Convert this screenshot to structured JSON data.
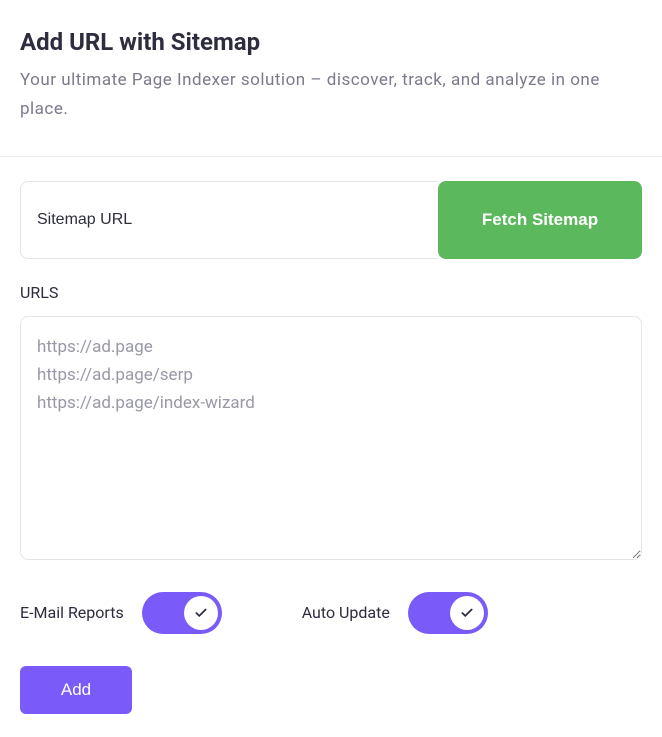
{
  "header": {
    "title": "Add URL with Sitemap",
    "subtitle": "Your ultimate Page Indexer solution – discover, track, and analyze in one place."
  },
  "form": {
    "sitemap_placeholder": "Sitemap URL",
    "sitemap_value": "",
    "fetch_button_label": "Fetch Sitemap",
    "urls_label": "URLS",
    "urls_value": "https://ad.page\nhttps://ad.page/serp\nhttps://ad.page/index-wizard"
  },
  "toggles": {
    "email_reports": {
      "label": "E-Mail Reports",
      "on": true
    },
    "auto_update": {
      "label": "Auto Update",
      "on": true
    }
  },
  "actions": {
    "add_label": "Add"
  },
  "colors": {
    "accent": "#7a5af8",
    "success": "#5cb85c"
  }
}
